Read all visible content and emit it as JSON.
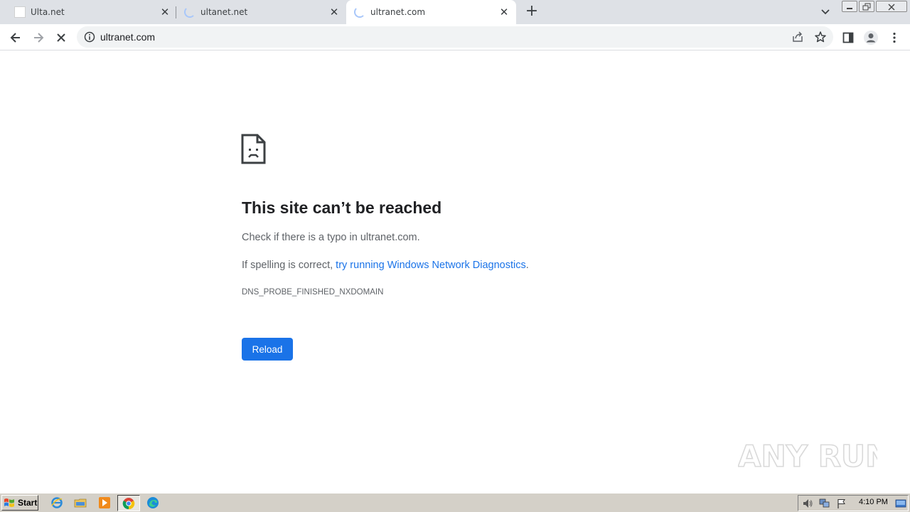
{
  "browser": {
    "tabs": [
      {
        "title": "Ulta.net",
        "favicon": "blank-page-icon",
        "active": false,
        "loading": false
      },
      {
        "title": "ultanet.net",
        "favicon": "loading-spinner-icon",
        "active": false,
        "loading": true
      },
      {
        "title": "ultranet.com",
        "favicon": "loading-spinner-icon",
        "active": true,
        "loading": true
      }
    ],
    "address_bar": {
      "url": "ultranet.com"
    }
  },
  "error_page": {
    "title": "This site can’t be reached",
    "line1": "Check if there is a typo in ultranet.com.",
    "line2_prefix": "If spelling is correct, ",
    "line2_link": "try running Windows Network Diagnostics",
    "line2_suffix": ".",
    "error_code": "DNS_PROBE_FINISHED_NXDOMAIN",
    "reload_label": "Reload"
  },
  "watermark": {
    "text": "ANY RUN"
  },
  "taskbar": {
    "start_label": "Start",
    "clock": "4:10 PM"
  },
  "colors": {
    "accent": "#1a73e8",
    "tabstrip": "#dee1e6",
    "taskbar": "#d4d0c8"
  }
}
